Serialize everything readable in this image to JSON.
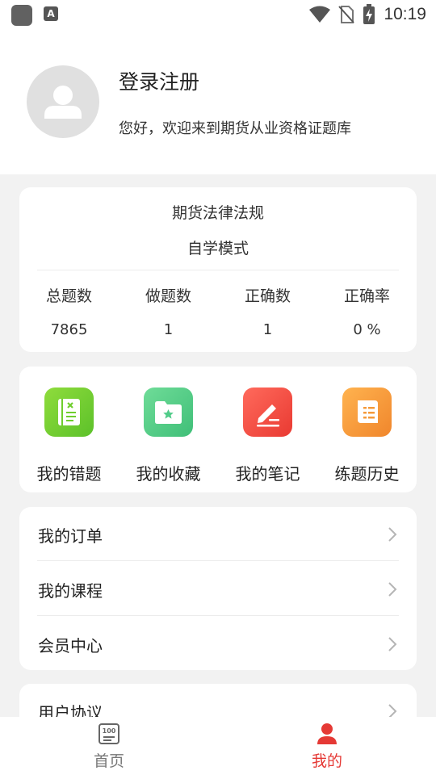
{
  "status_bar": {
    "time": "10:19",
    "notif_letter": "A"
  },
  "profile": {
    "login_label": "登录注册",
    "welcome_text": "您好，欢迎来到期货从业资格证题库"
  },
  "stats": {
    "subject": "期货法律法规",
    "mode": "自学模式",
    "items": [
      {
        "label": "总题数",
        "value": "7865"
      },
      {
        "label": "做题数",
        "value": "1"
      },
      {
        "label": "正确数",
        "value": "1"
      },
      {
        "label": "正确率",
        "value": "0 %"
      }
    ]
  },
  "tools": [
    {
      "label": "我的错题",
      "icon": "wrong-questions-icon",
      "color": "#6fce2e"
    },
    {
      "label": "我的收藏",
      "icon": "favorites-folder-icon",
      "color": "#52cc8a"
    },
    {
      "label": "我的笔记",
      "icon": "notes-pen-icon",
      "color": "#f25045"
    },
    {
      "label": "练题历史",
      "icon": "history-scroll-icon",
      "color": "#f59a3a"
    }
  ],
  "menu": [
    {
      "label": "我的订单"
    },
    {
      "label": "我的课程"
    },
    {
      "label": "会员中心"
    }
  ],
  "menu2": [
    {
      "label": "用户协议"
    }
  ],
  "tabbar": {
    "tabs": [
      {
        "label": "首页",
        "icon": "home-100-icon",
        "active": false
      },
      {
        "label": "我的",
        "icon": "profile-person-icon",
        "active": true
      }
    ],
    "active_color": "#e53935",
    "inactive_color": "#777777"
  }
}
